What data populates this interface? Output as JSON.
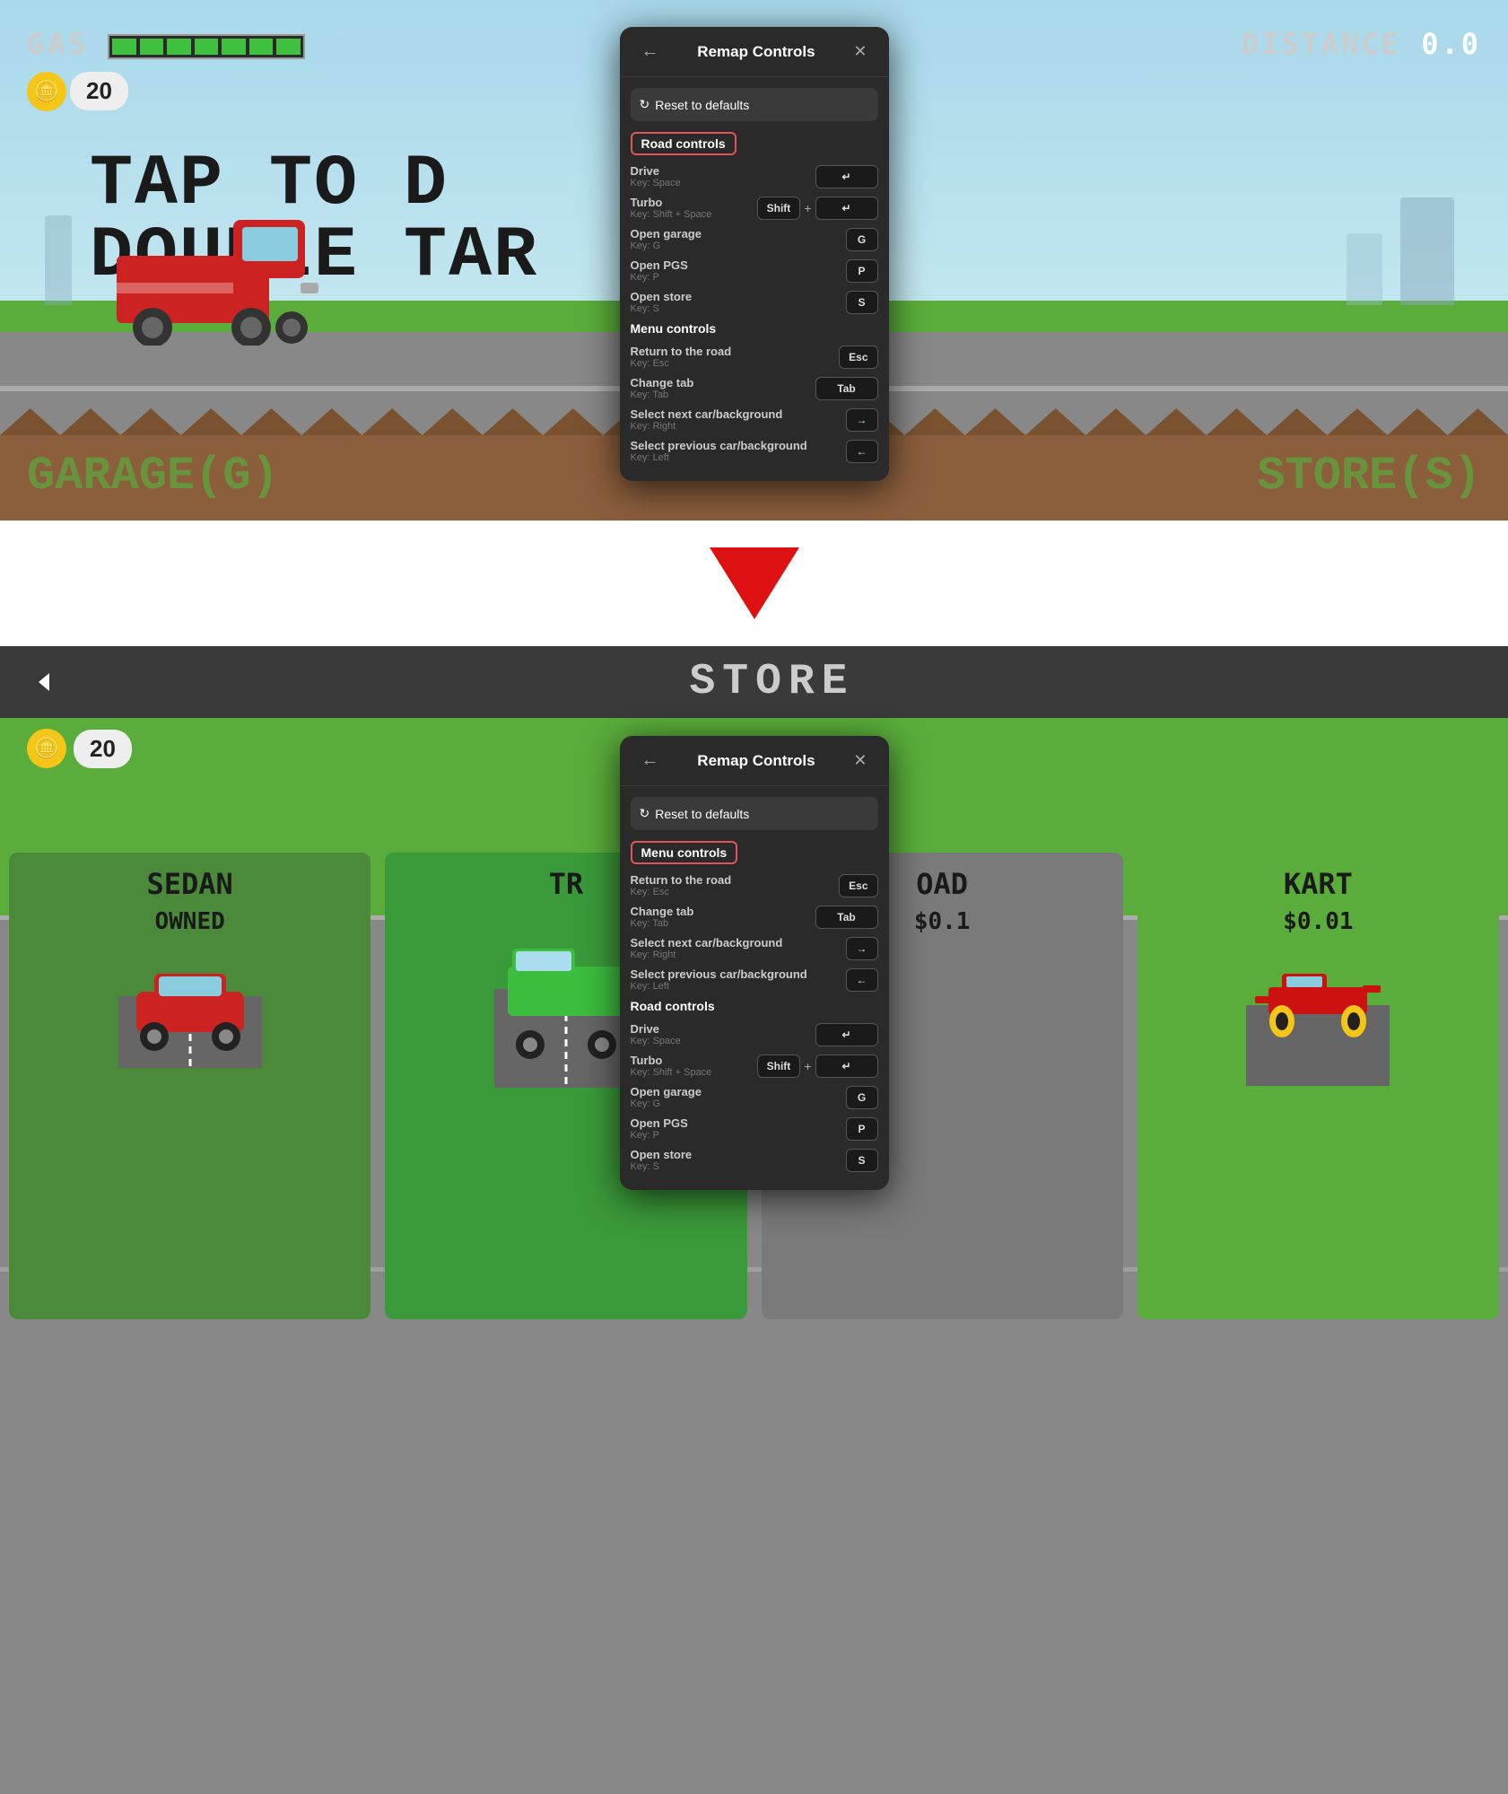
{
  "top": {
    "gas_label": "GAS",
    "distance_label": "DISTANCE",
    "distance_value": "0.0",
    "coin_icon": "🪙",
    "coin_count": "20",
    "tap_text": "TAP TO D",
    "double_tap_text": "DOUBLE TAR",
    "garage_label": "GARAGE(G)",
    "store_label": "STORE(S)"
  },
  "bottom": {
    "store_title": "STORE",
    "coin_count": "20",
    "cars": [
      {
        "title": "SEDAN",
        "subtitle": "OWNED",
        "color": "#cc2222"
      },
      {
        "title": "TR",
        "subtitle": "",
        "color": "#3a9a3a"
      },
      {
        "title": "OAD",
        "subtitle": "$0.1",
        "color": "#7a7a7a"
      },
      {
        "title": "KART",
        "subtitle": "$0.01",
        "color": "#5aad3b"
      }
    ]
  },
  "modal": {
    "title": "Remap Controls",
    "reset_label": "Reset to defaults",
    "top_active_section": "Road controls",
    "bottom_active_section": "Menu controls",
    "sections": {
      "road_controls": {
        "label": "Road controls",
        "items": [
          {
            "name": "Drive",
            "key_label": "Key: Space",
            "binding": "↵"
          },
          {
            "name": "Turbo",
            "key_label": "Key: Shift + Space",
            "binding1": "Shift",
            "binding2": "↵",
            "combo": true
          },
          {
            "name": "Open garage",
            "key_label": "Key: G",
            "binding": "G"
          },
          {
            "name": "Open PGS",
            "key_label": "Key: P",
            "binding": "P"
          },
          {
            "name": "Open store",
            "key_label": "Key: S",
            "binding": "S"
          }
        ]
      },
      "menu_controls": {
        "label": "Menu controls",
        "items": [
          {
            "name": "Return to the road",
            "key_label": "Key: Esc",
            "binding": "Esc"
          },
          {
            "name": "Change tab",
            "key_label": "Key: Tab",
            "binding": "Tab"
          },
          {
            "name": "Select next car/background",
            "key_label": "Key: Right",
            "binding": "→"
          },
          {
            "name": "Select previous car/background",
            "key_label": "Key: Left",
            "binding": "←"
          }
        ]
      }
    }
  },
  "arrow": "↓"
}
